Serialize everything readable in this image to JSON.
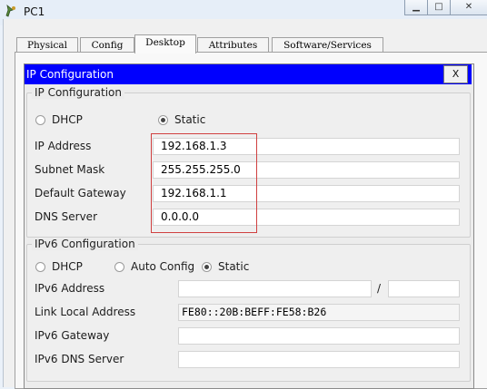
{
  "window": {
    "title": "PC1"
  },
  "tabs": [
    {
      "label": "Physical"
    },
    {
      "label": "Config"
    },
    {
      "label": "Desktop"
    },
    {
      "label": "Attributes"
    },
    {
      "label": "Software/Services"
    }
  ],
  "active_tab": "Desktop",
  "dialog": {
    "title": "IP Configuration",
    "close_label": "X",
    "ipv4": {
      "legend": "IP Configuration",
      "dhcp_label": "DHCP",
      "static_label": "Static",
      "mode": "Static",
      "ip_address_label": "IP Address",
      "ip_address": "192.168.1.3",
      "subnet_mask_label": "Subnet Mask",
      "subnet_mask": "255.255.255.0",
      "default_gateway_label": "Default Gateway",
      "default_gateway": "192.168.1.1",
      "dns_server_label": "DNS Server",
      "dns_server": "0.0.0.0"
    },
    "ipv6": {
      "legend": "IPv6 Configuration",
      "dhcp_label": "DHCP",
      "auto_config_label": "Auto Config",
      "static_label": "Static",
      "mode": "Static",
      "address_label": "IPv6 Address",
      "address": "",
      "prefix_separator": "/",
      "prefix_length": "",
      "link_local_label": "Link Local Address",
      "link_local": "FE80::20B:BEFF:FE58:B26",
      "gateway_label": "IPv6 Gateway",
      "gateway": "",
      "dns_label": "IPv6 DNS Server",
      "dns": ""
    }
  },
  "colors": {
    "dialog_titlebar": "#0000fe",
    "highlight_box": "#d04040"
  }
}
